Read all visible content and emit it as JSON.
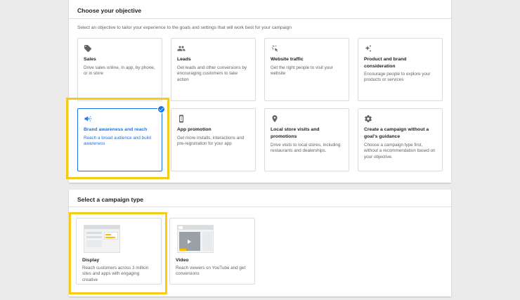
{
  "objective": {
    "title": "Choose your objective",
    "subtitle": "Select an objective to tailor your experience to the goals and settings that will work best for your campaign",
    "cards": [
      {
        "title": "Sales",
        "desc": "Drive sales online, in app, by phone, or in store",
        "icon": "tag-icon"
      },
      {
        "title": "Leads",
        "desc": "Get leads and other conversions by encouraging customers to take action",
        "icon": "people-icon"
      },
      {
        "title": "Website traffic",
        "desc": "Get the right people to visit your website",
        "icon": "cursor-click-icon"
      },
      {
        "title": "Product and brand consideration",
        "desc": "Encourage people to explore your products or services",
        "icon": "sparkle-icon"
      },
      {
        "title": "Brand awareness and reach",
        "desc": "Reach a broad audience and build awareness",
        "icon": "megaphone-icon",
        "selected": true
      },
      {
        "title": "App promotion",
        "desc": "Get more installs, interactions and pre-registration for your app",
        "icon": "phone-icon"
      },
      {
        "title": "Local store visits and promotions",
        "desc": "Drive visits to local stores, including restaurants and dealerships.",
        "icon": "location-pin-icon"
      },
      {
        "title": "Create a campaign without a goal's guidance",
        "desc": "Choose a campaign type first, without a recommendation based on your objective.",
        "icon": "gear-icon"
      }
    ]
  },
  "campaign_type": {
    "title": "Select a campaign type",
    "cards": [
      {
        "title": "Display",
        "desc": "Reach customers across 3 million sites and apps with engaging creative",
        "icon": "display-thumbnail"
      },
      {
        "title": "Video",
        "desc": "Reach viewers on YouTube and get conversions",
        "icon": "video-thumbnail"
      }
    ]
  },
  "colors": {
    "accent": "#1a73e8",
    "highlight": "#f7ca18"
  }
}
